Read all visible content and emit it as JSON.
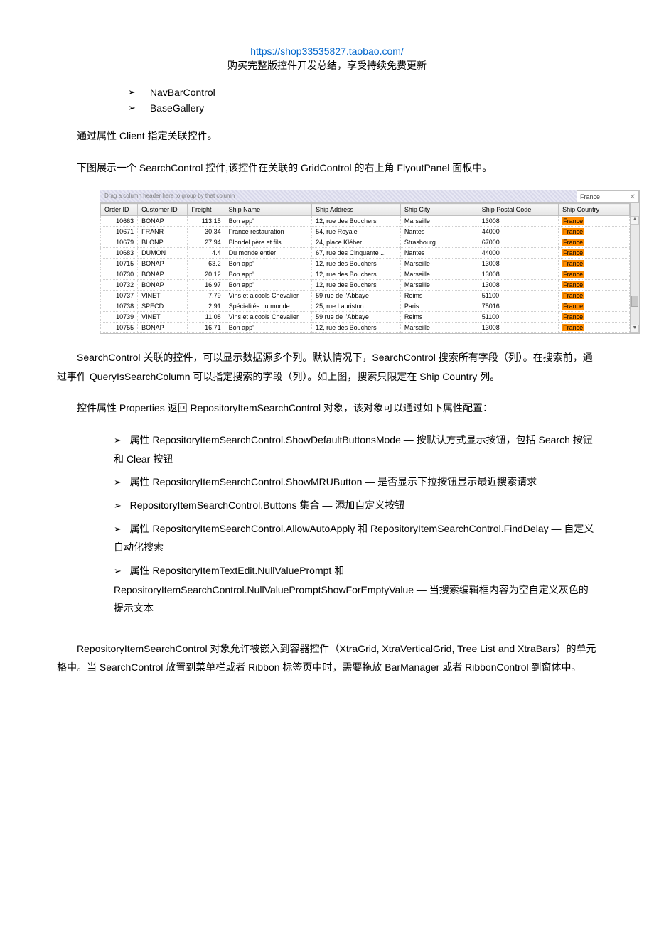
{
  "header": {
    "url": "https://shop33535827.taobao.com/",
    "subtitle": "购买完整版控件开发总结，享受持续免费更新"
  },
  "topBullets": [
    "NavBarControl",
    "BaseGallery"
  ],
  "paragraphs": {
    "p1": "通过属性 Client 指定关联控件。",
    "p2": "下图展示一个 SearchControl 控件,该控件在关联的 GridControl 的右上角 FlyoutPanel 面板中。",
    "p3": "SearchControl 关联的控件，可以显示数据源多个列。默认情况下，SearchControl 搜索所有字段（列）。在搜索前，通过事件 QueryIsSearchColumn 可以指定搜索的字段（列）。如上图，搜索只限定在 Ship Country 列。",
    "p4": "控件属性 Properties 返回 RepositoryItemSearchControl 对象，该对象可以通过如下属性配置：",
    "p5": "RepositoryItemSearchControl 对象允许被嵌入到容器控件（XtraGrid, XtraVerticalGrid, Tree List and XtraBars）的单元格中。当 SearchControl 放置到菜单栏或者 Ribbon 标签页中时，需要拖放 BarManager 或者 RibbonControl 到窗体中。"
  },
  "propsBullets": [
    "属性 RepositoryItemSearchControl.ShowDefaultButtonsMode — 按默认方式显示按钮，包括 Search 按钮和 Clear 按钮",
    "属性 RepositoryItemSearchControl.ShowMRUButton — 是否显示下拉按钮显示最近搜索请求",
    "RepositoryItemSearchControl.Buttons 集合 — 添加自定义按钮",
    "属性 RepositoryItemSearchControl.AllowAutoApply 和 RepositoryItemSearchControl.FindDelay — 自定义自动化搜索",
    "属性 RepositoryItemTextEdit.NullValuePrompt 和 RepositoryItemSearchControl.NullValuePromptShowForEmptyValue — 当搜索编辑框内容为空自定义灰色的提示文本"
  ],
  "grid": {
    "groupPanelText": "Drag a column header here to group by that column",
    "search": {
      "value": "France"
    },
    "columns": [
      {
        "key": "orderId",
        "label": "Order ID"
      },
      {
        "key": "customerId",
        "label": "Customer ID"
      },
      {
        "key": "freight",
        "label": "Freight"
      },
      {
        "key": "shipName",
        "label": "Ship Name"
      },
      {
        "key": "shipAddress",
        "label": "Ship Address"
      },
      {
        "key": "shipCity",
        "label": "Ship City"
      },
      {
        "key": "shipPostalCode",
        "label": "Ship Postal Code"
      },
      {
        "key": "shipCountry",
        "label": "Ship Country"
      }
    ],
    "rows": [
      {
        "orderId": "10663",
        "customerId": "BONAP",
        "freight": "113.15",
        "shipName": "Bon app'",
        "shipAddress": "12, rue des Bouchers",
        "shipCity": "Marseille",
        "shipPostalCode": "13008",
        "shipCountry": "France"
      },
      {
        "orderId": "10671",
        "customerId": "FRANR",
        "freight": "30.34",
        "shipName": "France restauration",
        "shipAddress": "54, rue Royale",
        "shipCity": "Nantes",
        "shipPostalCode": "44000",
        "shipCountry": "France"
      },
      {
        "orderId": "10679",
        "customerId": "BLONP",
        "freight": "27.94",
        "shipName": "Blondel père et fils",
        "shipAddress": "24, place Kléber",
        "shipCity": "Strasbourg",
        "shipPostalCode": "67000",
        "shipCountry": "France"
      },
      {
        "orderId": "10683",
        "customerId": "DUMON",
        "freight": "4.4",
        "shipName": "Du monde entier",
        "shipAddress": "67, rue des Cinquante ...",
        "shipCity": "Nantes",
        "shipPostalCode": "44000",
        "shipCountry": "France"
      },
      {
        "orderId": "10715",
        "customerId": "BONAP",
        "freight": "63.2",
        "shipName": "Bon app'",
        "shipAddress": "12, rue des Bouchers",
        "shipCity": "Marseille",
        "shipPostalCode": "13008",
        "shipCountry": "France"
      },
      {
        "orderId": "10730",
        "customerId": "BONAP",
        "freight": "20.12",
        "shipName": "Bon app'",
        "shipAddress": "12, rue des Bouchers",
        "shipCity": "Marseille",
        "shipPostalCode": "13008",
        "shipCountry": "France"
      },
      {
        "orderId": "10732",
        "customerId": "BONAP",
        "freight": "16.97",
        "shipName": "Bon app'",
        "shipAddress": "12, rue des Bouchers",
        "shipCity": "Marseille",
        "shipPostalCode": "13008",
        "shipCountry": "France"
      },
      {
        "orderId": "10737",
        "customerId": "VINET",
        "freight": "7.79",
        "shipName": "Vins et alcools Chevalier",
        "shipAddress": "59 rue de l'Abbaye",
        "shipCity": "Reims",
        "shipPostalCode": "51100",
        "shipCountry": "France"
      },
      {
        "orderId": "10738",
        "customerId": "SPECD",
        "freight": "2.91",
        "shipName": "Spécialités du monde",
        "shipAddress": "25, rue Lauriston",
        "shipCity": "Paris",
        "shipPostalCode": "75016",
        "shipCountry": "France"
      },
      {
        "orderId": "10739",
        "customerId": "VINET",
        "freight": "11.08",
        "shipName": "Vins et alcools Chevalier",
        "shipAddress": "59 rue de l'Abbaye",
        "shipCity": "Reims",
        "shipPostalCode": "51100",
        "shipCountry": "France"
      },
      {
        "orderId": "10755",
        "customerId": "BONAP",
        "freight": "16.71",
        "shipName": "Bon app'",
        "shipAddress": "12, rue des Bouchers",
        "shipCity": "Marseille",
        "shipPostalCode": "13008",
        "shipCountry": "France"
      }
    ]
  }
}
